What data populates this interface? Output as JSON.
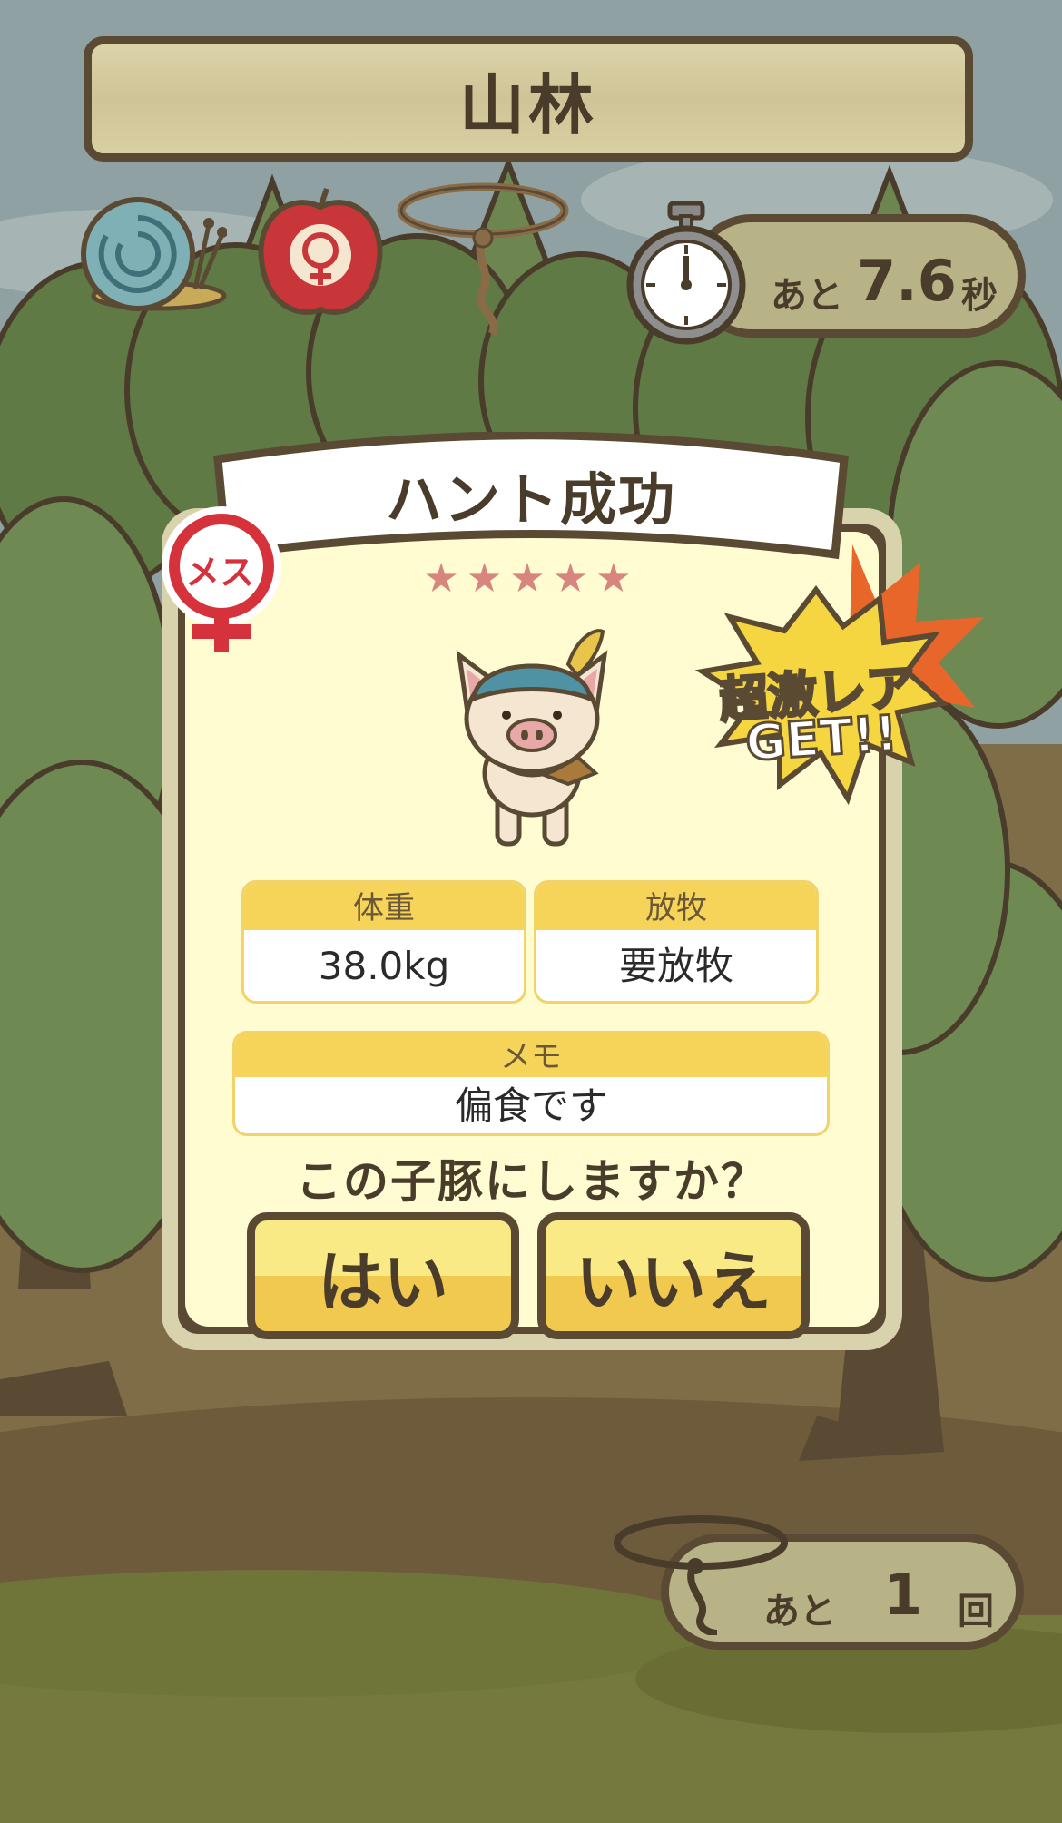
{
  "header": {
    "title": "山林"
  },
  "status_icons": [
    "snail-icon",
    "apple-female-icon",
    "lasso-icon"
  ],
  "timer": {
    "prefix": "あと",
    "value": "7.6",
    "unit": "秒"
  },
  "result": {
    "title": "ハント成功",
    "gender_badge": "メス",
    "stars": "★★★★★",
    "rarity_badge": [
      "超激レア",
      "GET!!"
    ],
    "weight_label": "体重",
    "weight_value": "38.0kg",
    "grazing_label": "放牧",
    "grazing_value": "要放牧",
    "memo_label": "メモ",
    "memo_value": "偏食です",
    "question": "この子豚にしますか？",
    "yes_label": "はい",
    "no_label": "いいえ"
  },
  "lasso_remaining": {
    "prefix": "あと",
    "value": "1",
    "unit": "回"
  },
  "colors": {
    "frame": "#5b4a33",
    "card_bg": "#fefcd0",
    "button_top": "#f9ea85",
    "button_bottom": "#f1c94e",
    "badge_red": "#d6323c"
  }
}
